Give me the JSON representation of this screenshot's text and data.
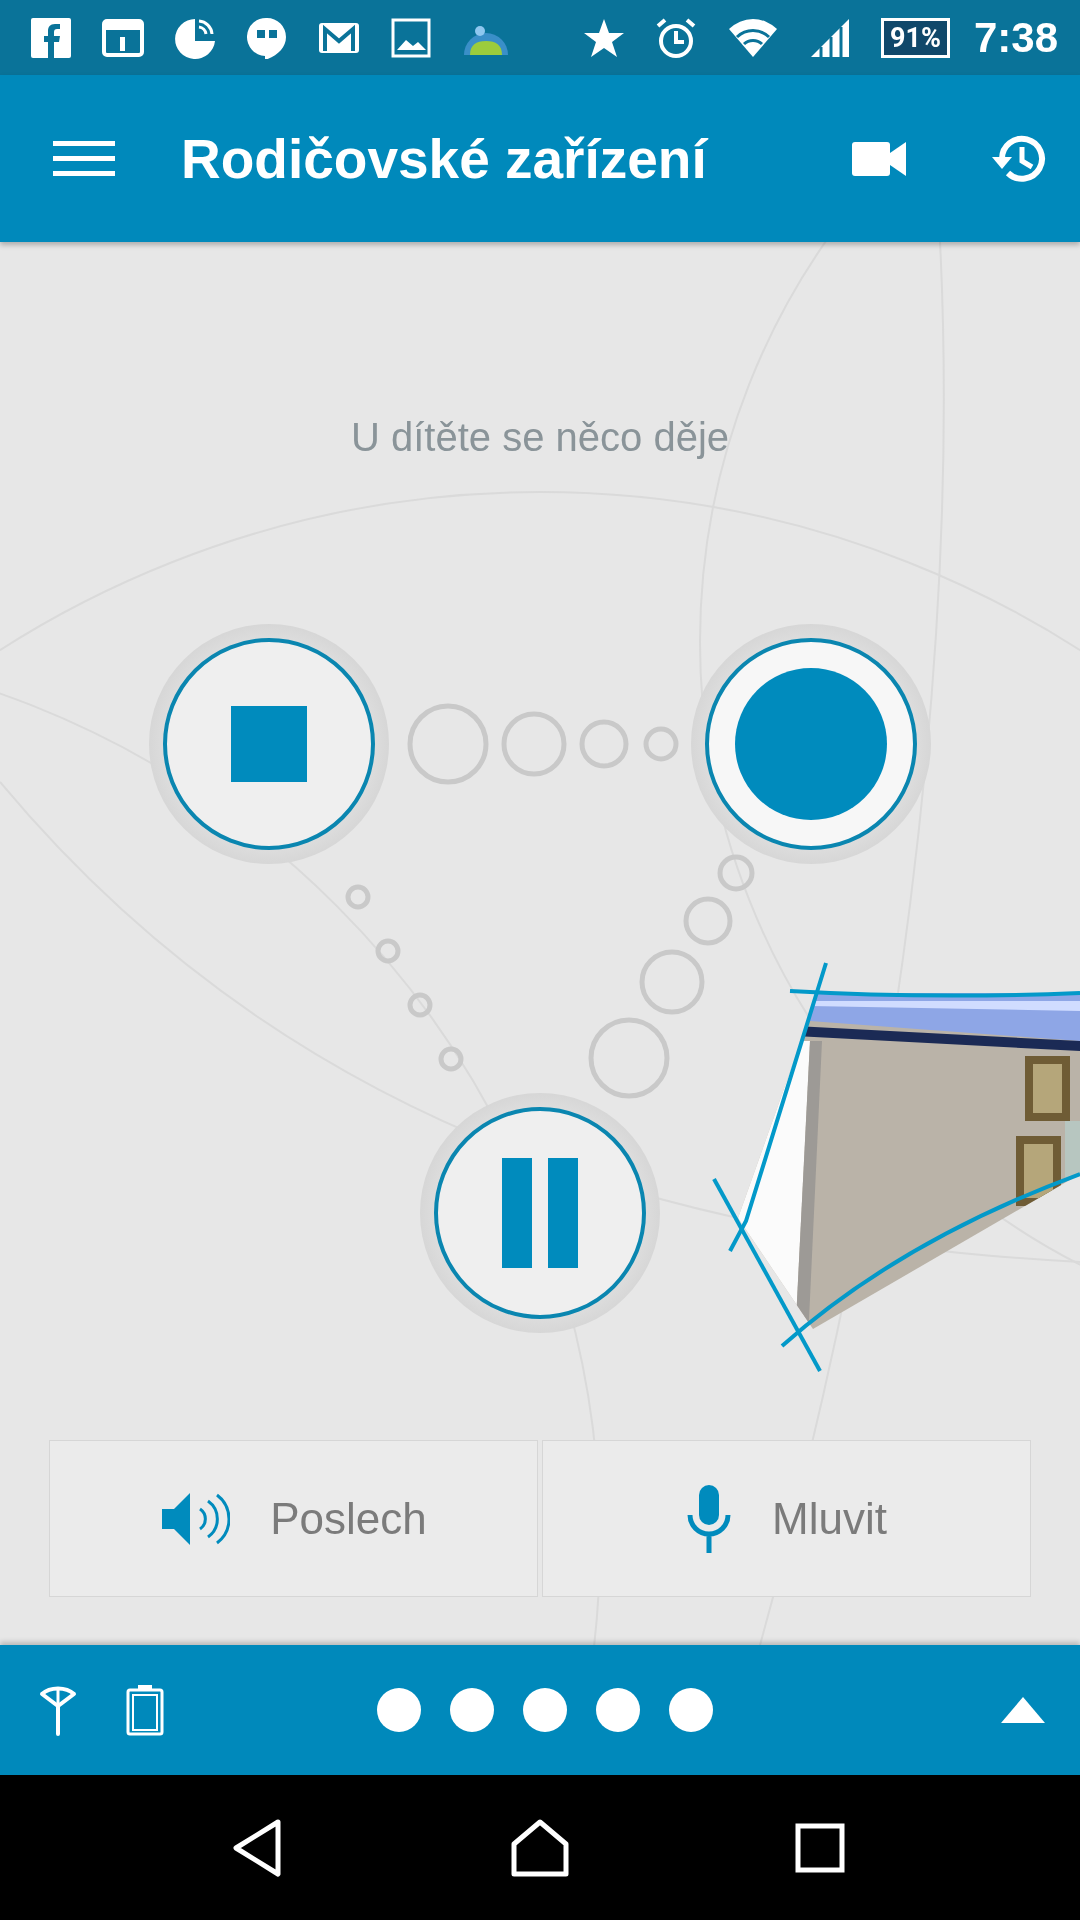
{
  "status_bar": {
    "battery": "91%",
    "time": "7:38"
  },
  "app_bar": {
    "title": "Rodičovské zařízení"
  },
  "status_message": "U dítěte se něco děje",
  "controls": [
    {
      "kind": "stop"
    },
    {
      "kind": "record"
    },
    {
      "kind": "pause"
    }
  ],
  "actions": [
    {
      "kind": "speaker",
      "label": "Poslech"
    },
    {
      "kind": "mic",
      "label": "Mluvit"
    }
  ]
}
